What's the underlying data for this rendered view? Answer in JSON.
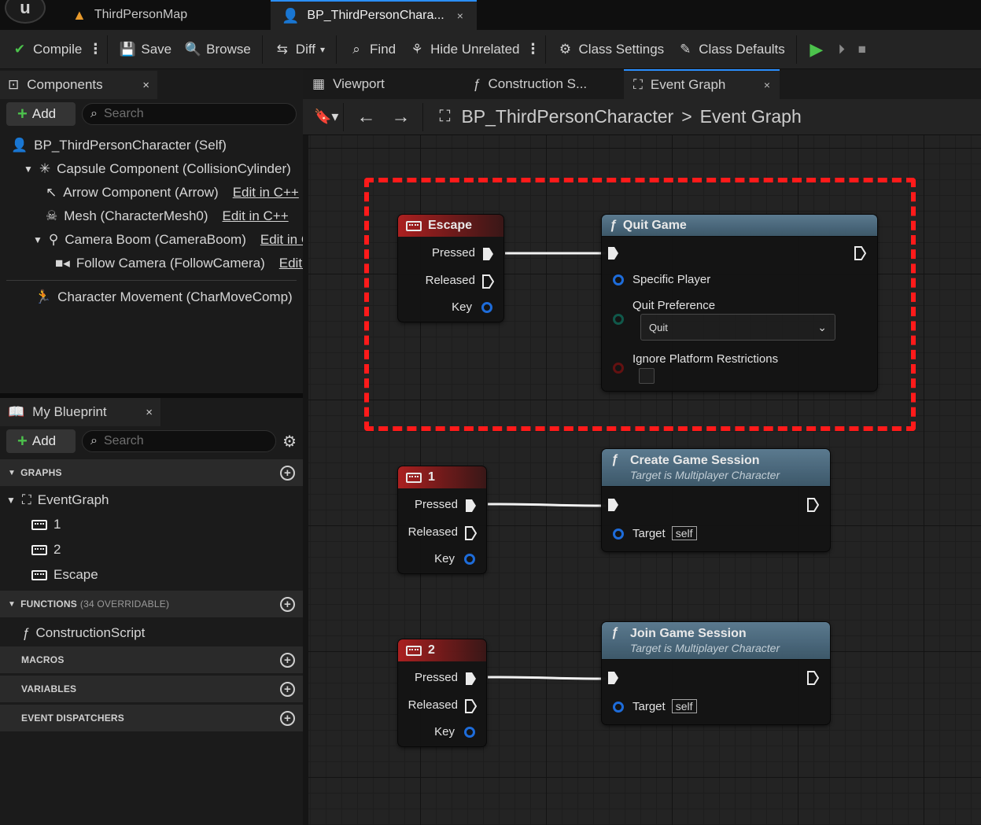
{
  "titlebar": {
    "logo": "unreal-logo",
    "tabs": [
      {
        "label": "ThirdPersonMap",
        "icon": "level-icon"
      },
      {
        "label": "BP_ThirdPersonChara...",
        "icon": "character-blueprint-icon",
        "close": "×"
      }
    ]
  },
  "toolbar": {
    "compile": "Compile",
    "save": "Save",
    "browse": "Browse",
    "diff": "Diff",
    "find": "Find",
    "hide_unrelated": "Hide Unrelated",
    "class_settings": "Class Settings",
    "class_defaults": "Class Defaults"
  },
  "components_panel": {
    "title": "Components",
    "close": "×",
    "add": "Add",
    "search_placeholder": "Search",
    "tree": [
      {
        "label": "BP_ThirdPersonCharacter (Self)"
      },
      {
        "label": "Capsule Component (CollisionCylinder)"
      },
      {
        "label": "Arrow Component (Arrow)",
        "link": "Edit in C++"
      },
      {
        "label": "Mesh (CharacterMesh0)",
        "link": "Edit in C++"
      },
      {
        "label": "Camera Boom (CameraBoom)",
        "link": "Edit in C++"
      },
      {
        "label": "Follow Camera (FollowCamera)",
        "link": "Edit in C++"
      },
      {
        "label": "Character Movement (CharMoveComp)"
      }
    ]
  },
  "my_blueprint": {
    "title": "My Blueprint",
    "close": "×",
    "add": "Add",
    "search_placeholder": "Search",
    "graphs_header": "GRAPHS",
    "event_graph": "EventGraph",
    "events": [
      "1",
      "2",
      "Escape"
    ],
    "functions_header": "FUNCTIONS",
    "functions_sub": "(34 OVERRIDABLE)",
    "construction_script": "ConstructionScript",
    "macros_header": "MACROS",
    "variables_header": "VARIABLES",
    "dispatchers_header": "EVENT DISPATCHERS"
  },
  "graph_tabs": [
    {
      "label": "Viewport",
      "icon": "viewport-icon"
    },
    {
      "label": "Construction S...",
      "icon": "function-icon"
    },
    {
      "label": "Event Graph",
      "icon": "event-graph-icon",
      "close": "×"
    }
  ],
  "breadcrumb": {
    "blueprint": "BP_ThirdPersonCharacter",
    "separator": ">",
    "graph": "Event Graph"
  },
  "nodes": {
    "escape": {
      "title": "Escape",
      "pressed": "Pressed",
      "released": "Released",
      "key": "Key"
    },
    "quit_game": {
      "title": "Quit Game",
      "specific_player": "Specific Player",
      "quit_preference": "Quit Preference",
      "dropdown_value": "Quit",
      "ignore_platform": "Ignore Platform Restrictions"
    },
    "key1": {
      "title": "1",
      "pressed": "Pressed",
      "released": "Released",
      "key": "Key"
    },
    "create_session": {
      "title": "Create Game Session",
      "subtitle": "Target is Multiplayer Character",
      "target": "Target",
      "self": "self"
    },
    "key2": {
      "title": "2",
      "pressed": "Pressed",
      "released": "Released",
      "key": "Key"
    },
    "join_session": {
      "title": "Join Game Session",
      "subtitle": "Target is Multiplayer Character",
      "target": "Target",
      "self": "self"
    }
  },
  "colors": {
    "accent": "#2b8fff",
    "selection": "#ff1a1a",
    "event_node": "#b02020",
    "function_node": "#4f6f84",
    "add_plus": "#4cc24c"
  }
}
